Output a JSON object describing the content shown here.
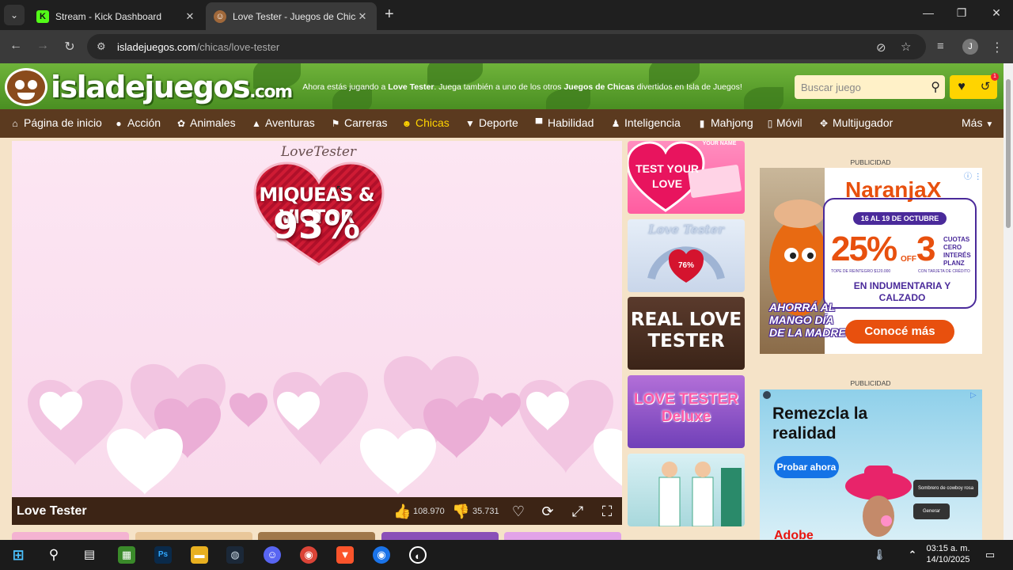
{
  "browser": {
    "tabs": [
      {
        "title": "Stream - Kick Dashboard",
        "icon": "kick-icon"
      },
      {
        "title": "Love Tester - Juegos de Chicas",
        "icon": "isladejuegos-icon"
      }
    ],
    "url_host": "isladejuegos.com",
    "url_path": "/chicas/love-tester",
    "profile_initial": "J"
  },
  "site": {
    "logo_main": "isladejuegos",
    "logo_suffix": ".com",
    "msg_prefix": "Ahora estás jugando a ",
    "msg_game": "Love Tester",
    "msg_middle": ". Juega también a uno de los otros ",
    "msg_category": "Juegos de Chicas",
    "msg_suffix": " divertidos en Isla de Juegos!",
    "search_placeholder": "Buscar juego",
    "history_count": "1"
  },
  "categories": [
    {
      "label": "Página de inicio",
      "icon": "home-icon"
    },
    {
      "label": "Acción",
      "icon": "bomb-icon"
    },
    {
      "label": "Animales",
      "icon": "paw-icon"
    },
    {
      "label": "Aventuras",
      "icon": "hat-icon"
    },
    {
      "label": "Carreras",
      "icon": "flag-icon"
    },
    {
      "label": "Chicas",
      "icon": "girl-icon",
      "active": true
    },
    {
      "label": "Deporte",
      "icon": "shirt-icon"
    },
    {
      "label": "Habilidad",
      "icon": "anvil-icon"
    },
    {
      "label": "Inteligencia",
      "icon": "chess-icon"
    },
    {
      "label": "Mahjong",
      "icon": "tile-icon"
    },
    {
      "label": "Móvil",
      "icon": "phone-icon"
    },
    {
      "label": "Multijugador",
      "icon": "gamepad-icon"
    },
    {
      "label": "Más",
      "icon": "caret-down-icon"
    }
  ],
  "game": {
    "brand": "LoveTester",
    "heart_names": "MIQUEAS & VICTOR",
    "heart_percent": "93%",
    "title": "Love Tester",
    "likes": "108.970",
    "dislikes": "35.731"
  },
  "related": [
    {
      "text": "TEST YOUR LOVE",
      "sub": "YOUR NAME"
    },
    {
      "text": "Love Tester",
      "sub": "76%"
    },
    {
      "text": "REAL LOVE TESTER"
    },
    {
      "text": "LOVE TESTER Deluxe"
    },
    {
      "text": ""
    }
  ],
  "ads": {
    "label": "PUBLICIDAD",
    "ad1": {
      "brand": "NaranjaX",
      "dates": "16 AL 19 DE OCTUBRE",
      "pct": "25%",
      "off": "OFF",
      "cuotas": "3",
      "cuotas_txt": "CUOTAS CERO INTERÉS PLANZ",
      "tope": "TOPE DE REINTEGRO $120.000",
      "tarjeta": "CON TARJETA DE CRÉDITO",
      "line": "EN INDUMENTARIA Y CALZADO",
      "slogan": "AHORRÁ AL MANGO DÍA DE LA MADRE",
      "cta": "Conocé más"
    },
    "ad2": {
      "headline": "Remezcla la realidad",
      "cta": "Probar ahora",
      "chip1": "Sombrero de cowboy rosa",
      "chip2": "Generar",
      "brand": "Adobe"
    }
  },
  "taskbar": {
    "time": "03:15 a. m.",
    "date": "14/10/2025"
  }
}
